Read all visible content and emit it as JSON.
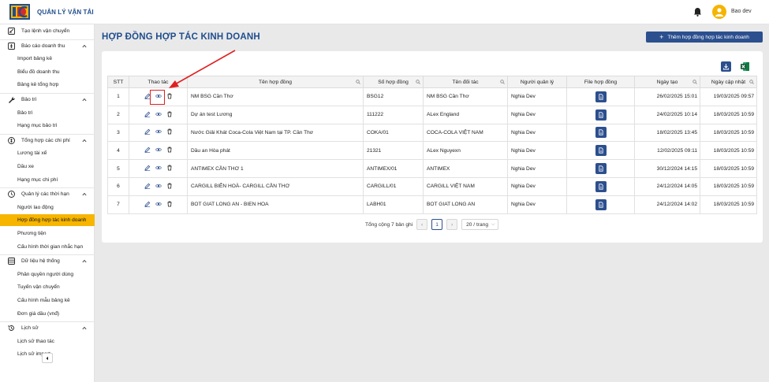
{
  "header": {
    "app_title": "QUẢN LÝ VẬN TẢI",
    "user_name": "Bao dev"
  },
  "sidebar": {
    "items": [
      {
        "label": "Tạo lệnh vận chuyển",
        "type": "group",
        "icon": "plus-square-icon",
        "chevron": false
      },
      {
        "label": "Báo cáo doanh thu",
        "type": "group",
        "icon": "dollar-square-icon",
        "chevron": true
      },
      {
        "label": "Import bảng kê",
        "type": "sub"
      },
      {
        "label": "Biểu đồ doanh thu",
        "type": "sub"
      },
      {
        "label": "Bảng kê tổng hợp",
        "type": "sub"
      },
      {
        "label": "Bảo trì",
        "type": "group",
        "icon": "wrench-icon",
        "chevron": true
      },
      {
        "label": "Bảo trì",
        "type": "sub"
      },
      {
        "label": "Hạng mục bảo trì",
        "type": "sub"
      },
      {
        "label": "Tổng hợp các chi phí",
        "type": "group",
        "icon": "dollar-circle-icon",
        "chevron": true
      },
      {
        "label": "Lương tài xế",
        "type": "sub"
      },
      {
        "label": "Dầu xe",
        "type": "sub"
      },
      {
        "label": "Hạng mục chi phí",
        "type": "sub"
      },
      {
        "label": "Quản lý các thời hạn",
        "type": "group",
        "icon": "clock-icon",
        "chevron": true
      },
      {
        "label": "Người lao động",
        "type": "sub"
      },
      {
        "label": "Hợp đồng hợp tác kinh doanh",
        "type": "sub",
        "active": true
      },
      {
        "label": "Phương tiện",
        "type": "sub"
      },
      {
        "label": "Cấu hình thời gian nhắc hạn",
        "type": "sub"
      },
      {
        "label": "Dữ liệu hệ thống",
        "type": "group",
        "icon": "database-icon",
        "chevron": true
      },
      {
        "label": "Phân quyền người dùng",
        "type": "sub"
      },
      {
        "label": "Tuyến vận chuyển",
        "type": "sub"
      },
      {
        "label": "Cấu hình mẫu bảng kê",
        "type": "sub"
      },
      {
        "label": "Đơn giá dầu (vnđ)",
        "type": "sub"
      },
      {
        "label": "Lịch sử",
        "type": "group",
        "icon": "history-icon",
        "chevron": true
      },
      {
        "label": "Lịch sử thao tác",
        "type": "sub"
      },
      {
        "label": "Lịch sử import",
        "type": "sub"
      }
    ]
  },
  "page": {
    "title": "HỢP ĐỒNG HỢP TÁC KINH DOANH",
    "add_button": "Thêm hợp đồng hợp tác kinh doanh"
  },
  "table": {
    "columns": [
      "STT",
      "Thao tác",
      "Tên hợp đồng",
      "Số hợp đồng",
      "Tên đối tác",
      "Người quản lý",
      "File hợp đồng",
      "Ngày tạo",
      "Ngày cập nhật"
    ],
    "rows": [
      {
        "stt": "1",
        "name": "NM BSG Cần Thơ",
        "number": "BSG12",
        "partner": "NM BSG Cần Thơ",
        "manager": "Nghia Dev",
        "created": "26/02/2025 15:01",
        "updated": "19/03/2025 09:57"
      },
      {
        "stt": "2",
        "name": "Dự án test Lương",
        "number": "111222",
        "partner": "ALex England",
        "manager": "Nghia Dev",
        "created": "24/02/2025 10:14",
        "updated": "18/03/2025 10:59"
      },
      {
        "stt": "3",
        "name": "Nước Giải Khát Coca-Cola Việt Nam tại TP. Cần Thơ",
        "number": "COKA/01",
        "partner": "COCA-COLA VIỆT NAM",
        "manager": "Nghia Dev",
        "created": "18/02/2025 13:45",
        "updated": "18/03/2025 10:59"
      },
      {
        "stt": "4",
        "name": "Dầu an Hòa phát",
        "number": "21321",
        "partner": "ALex Nguyexn",
        "manager": "Nghia Dev",
        "created": "12/02/2025 09:11",
        "updated": "18/03/2025 10:59"
      },
      {
        "stt": "5",
        "name": "ANTIMEX CẦN THƠ 1",
        "number": "ANTIMEX/01",
        "partner": "ANTIMEX",
        "manager": "Nghia Dev",
        "created": "30/12/2024 14:15",
        "updated": "18/03/2025 10:59"
      },
      {
        "stt": "6",
        "name": "CARGILL BIÊN HOÀ- CARGILL CẦN THƠ",
        "number": "CARGILL/01",
        "partner": "CARGILL VIỆT NAM",
        "manager": "Nghia Dev",
        "created": "24/12/2024 14:05",
        "updated": "18/03/2025 10:59"
      },
      {
        "stt": "7",
        "name": "BOT GIAT LONG AN - BIEN HOA",
        "number": "LABH01",
        "partner": "BOT GIAT LONG AN",
        "manager": "Nghia Dev",
        "created": "24/12/2024 14:02",
        "updated": "18/03/2025 10:59"
      }
    ]
  },
  "pagination": {
    "total_text": "Tổng cộng 7 bản ghi",
    "current_page": "1",
    "page_size": "20 / trang"
  },
  "colors": {
    "primary": "#2c4f8e",
    "accent": "#f7b500",
    "annotation": "#e02020",
    "excel": "#1d7a43"
  }
}
